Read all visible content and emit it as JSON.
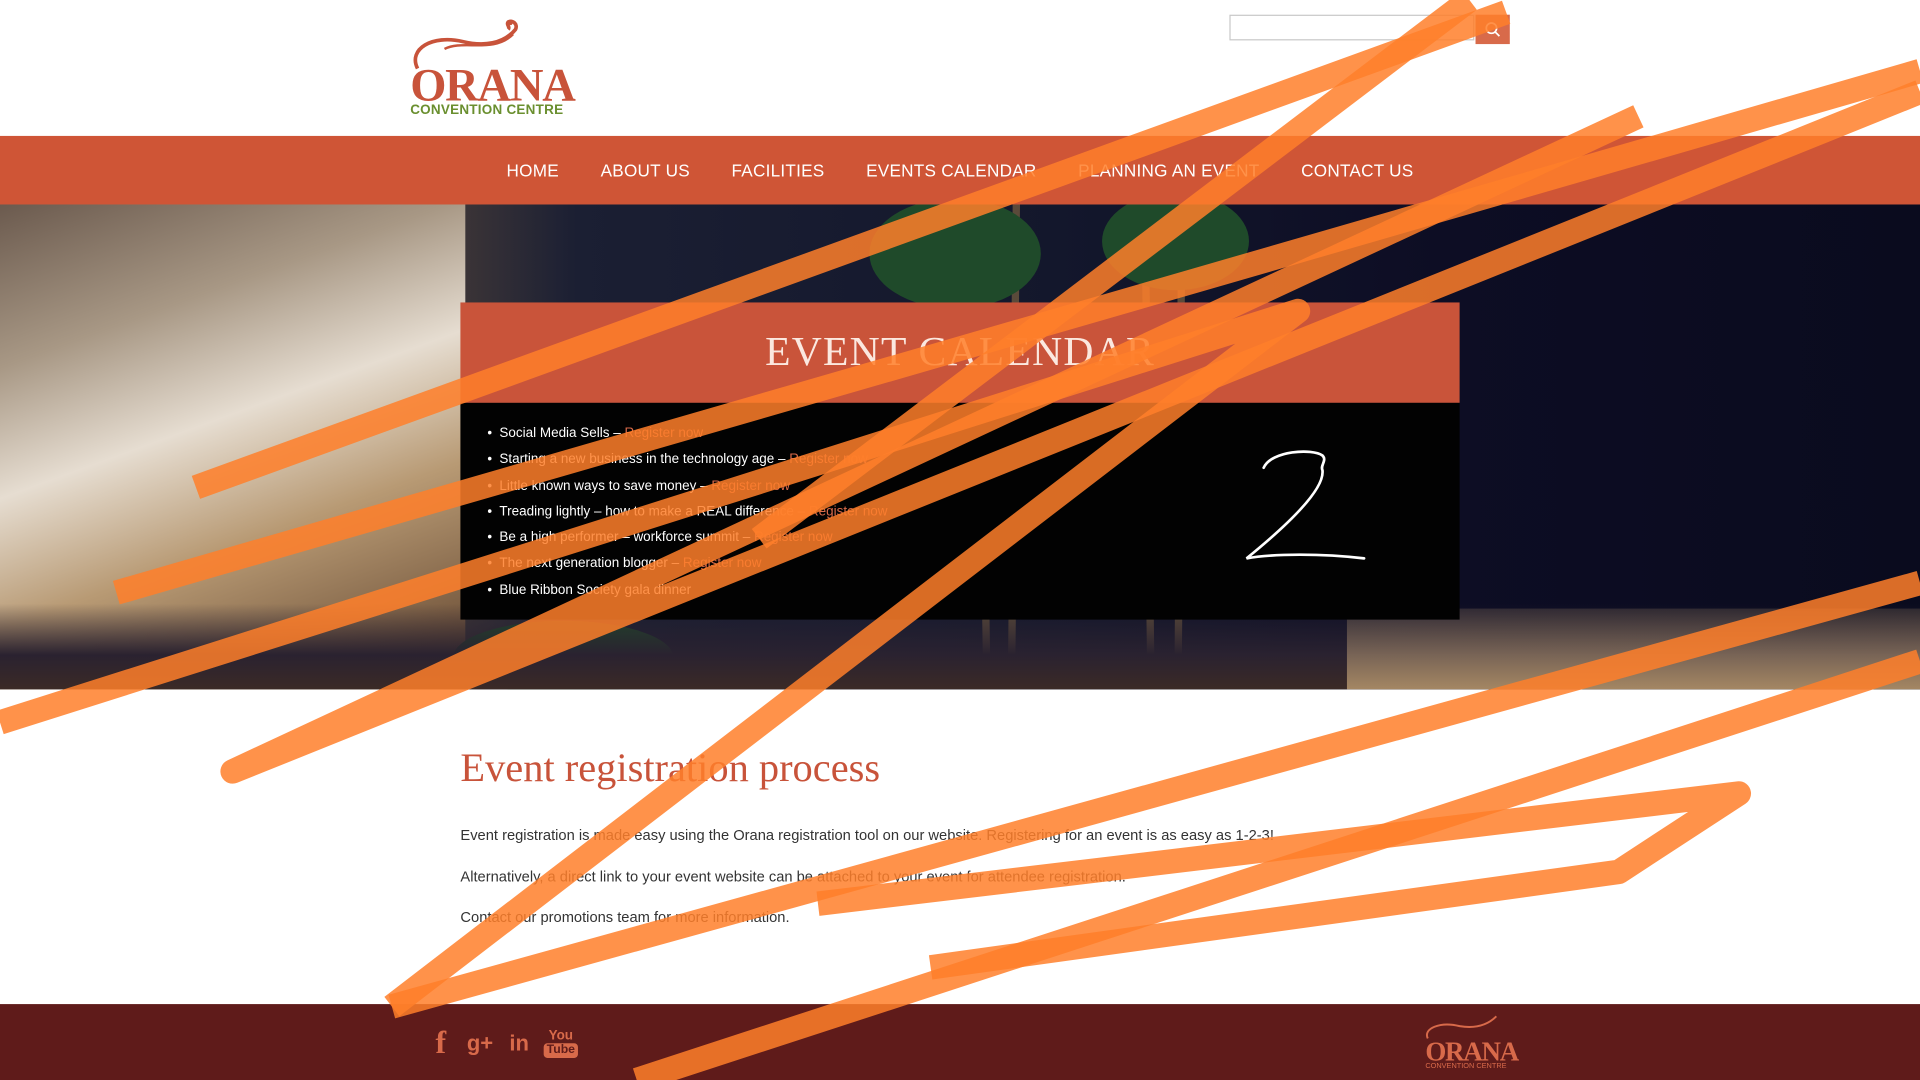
{
  "header": {
    "logo": {
      "word": "ORANA",
      "subtitle": "CONVENTION CENTRE"
    },
    "search": {
      "placeholder": "",
      "button_icon": "search-icon"
    }
  },
  "nav": {
    "items": [
      {
        "label": "HOME"
      },
      {
        "label": "ABOUT US"
      },
      {
        "label": "FACILITIES"
      },
      {
        "label": "EVENTS CALENDAR"
      },
      {
        "label": "PLANNING AN EVENT"
      },
      {
        "label": "CONTACT US"
      }
    ]
  },
  "calendar": {
    "title": "EVENT CALENDAR",
    "events": [
      {
        "name": "Social Media Sells",
        "link": "Register now"
      },
      {
        "name": "Starting a new business in the technology age",
        "link": "Register now"
      },
      {
        "name": "Little known ways to save money",
        "link": "Register now"
      },
      {
        "name": "Treading lightly – how to make a REAL difference",
        "link": "Register now"
      },
      {
        "name": "Be a high performer – workforce summit",
        "link": "Register now"
      },
      {
        "name": "The next generation blogger",
        "link": "Register now"
      },
      {
        "name": "Blue Ribbon Society gala dinner",
        "link": ""
      }
    ],
    "separator": " – ",
    "annotation": "2"
  },
  "content": {
    "title": "Event registration process",
    "paragraphs": [
      "Event registration is made easy using the Orana registration tool on our website. Registering for an event is as easy as 1-2-3!",
      "Alternatively, a direct link to your event website can be attached to your event for attendee registration.",
      "Contact our promotions team for more information."
    ]
  },
  "footer": {
    "social": [
      {
        "icon": "facebook-icon",
        "glyph": "f"
      },
      {
        "icon": "google-plus-icon",
        "glyph": "g+"
      },
      {
        "icon": "linkedin-icon",
        "glyph": "in"
      },
      {
        "icon": "youtube-icon",
        "glyph_top": "You",
        "glyph_bottom": "Tube"
      }
    ],
    "logo": {
      "word": "ORANA",
      "subtitle": "CONVENTION CENTRE"
    }
  },
  "colors": {
    "brand": "#c8533a",
    "nav_bg": "#cf5536",
    "footer_bg": "#5f1b1a",
    "scribble": "#ff7f2a"
  }
}
